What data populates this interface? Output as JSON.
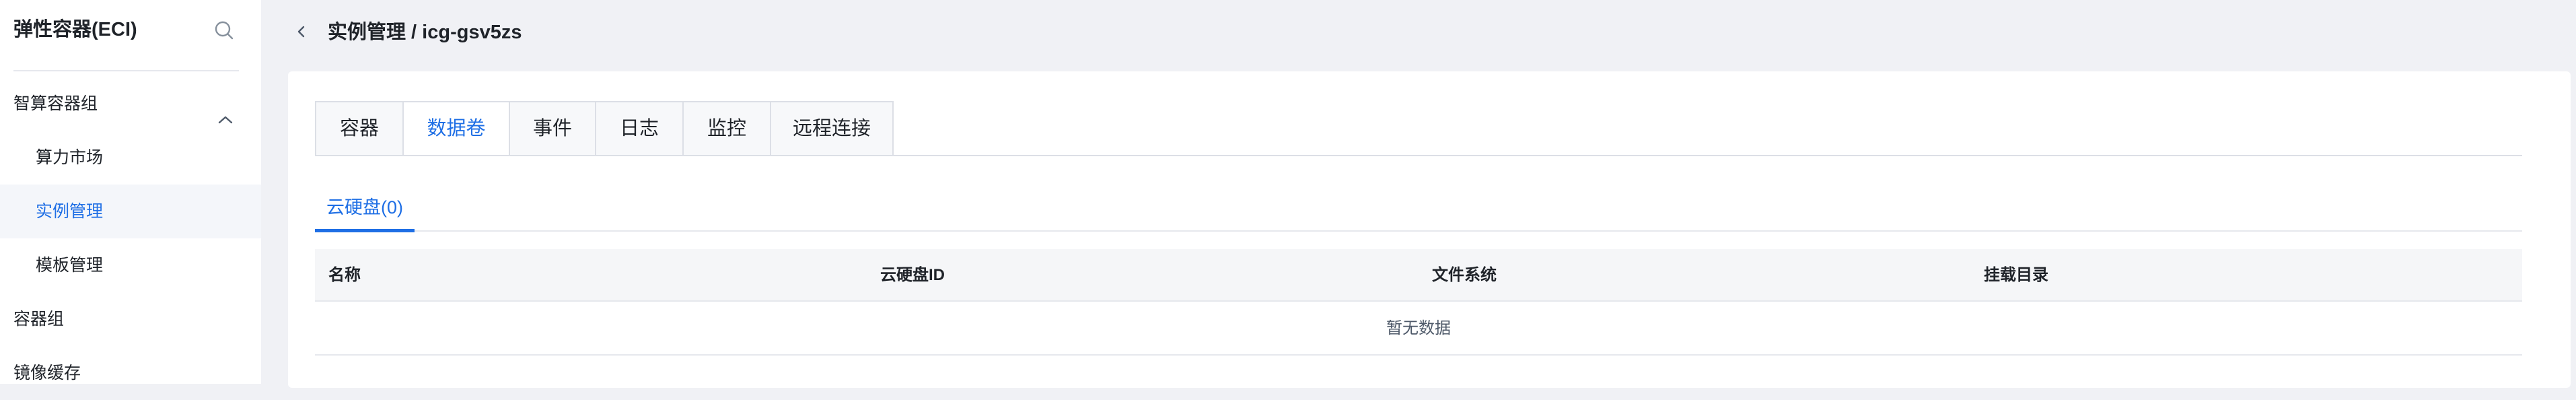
{
  "sidebar": {
    "title": "弹性容器(ECI)",
    "search_icon": "search-icon",
    "items": [
      {
        "label": "智算容器组",
        "expanded": true
      },
      {
        "label": "算力市场"
      },
      {
        "label": "实例管理",
        "active": true
      },
      {
        "label": "模板管理"
      },
      {
        "label": "容器组"
      },
      {
        "label": "镜像缓存"
      }
    ]
  },
  "header": {
    "breadcrumb": "实例管理 / icg-gsv5zs"
  },
  "tabs": [
    {
      "label": "容器"
    },
    {
      "label": "数据卷",
      "active": true
    },
    {
      "label": "事件"
    },
    {
      "label": "日志"
    },
    {
      "label": "监控"
    },
    {
      "label": "远程连接"
    }
  ],
  "subtabs": [
    {
      "label": "云硬盘(0)",
      "active": true
    }
  ],
  "table": {
    "columns": [
      "名称",
      "云硬盘ID",
      "文件系统",
      "挂载目录"
    ],
    "empty_text": "暂无数据"
  },
  "colors": {
    "accent": "#1f6fe5",
    "background": "#f0f1f5",
    "active_nav_bg": "#f4f6fa"
  }
}
